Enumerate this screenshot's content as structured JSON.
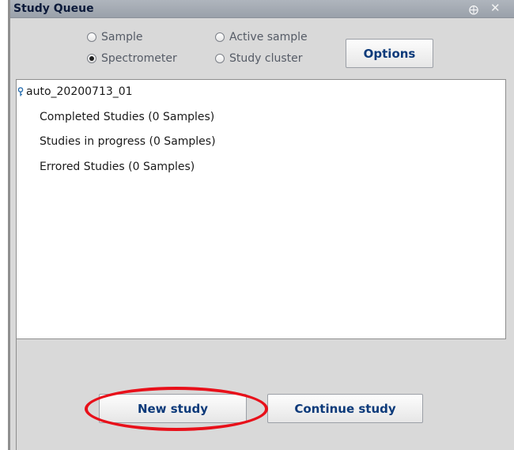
{
  "panel": {
    "title": "Study Queue",
    "pin_icon": "pin-icon",
    "close_icon": "close-icon"
  },
  "view_options": {
    "sample": {
      "label": "Sample",
      "checked": false
    },
    "active_sample": {
      "label": "Active sample",
      "checked": false
    },
    "spectrometer": {
      "label": "Spectrometer",
      "checked": true
    },
    "study_cluster": {
      "label": "Study cluster",
      "checked": false
    },
    "options_button": "Options"
  },
  "tree": {
    "root": {
      "label": "auto_20200713_01",
      "icon": "key-icon"
    },
    "children": [
      {
        "label": "Completed Studies (0 Samples)"
      },
      {
        "label": "Studies in progress (0 Samples)"
      },
      {
        "label": "Errored Studies (0 Samples)"
      }
    ]
  },
  "actions": {
    "new_study": "New study",
    "continue_study": "Continue study"
  },
  "colors": {
    "titlebar": "#a3aab3",
    "button_text": "#0c3a7a",
    "highlight": "#e8101a"
  }
}
